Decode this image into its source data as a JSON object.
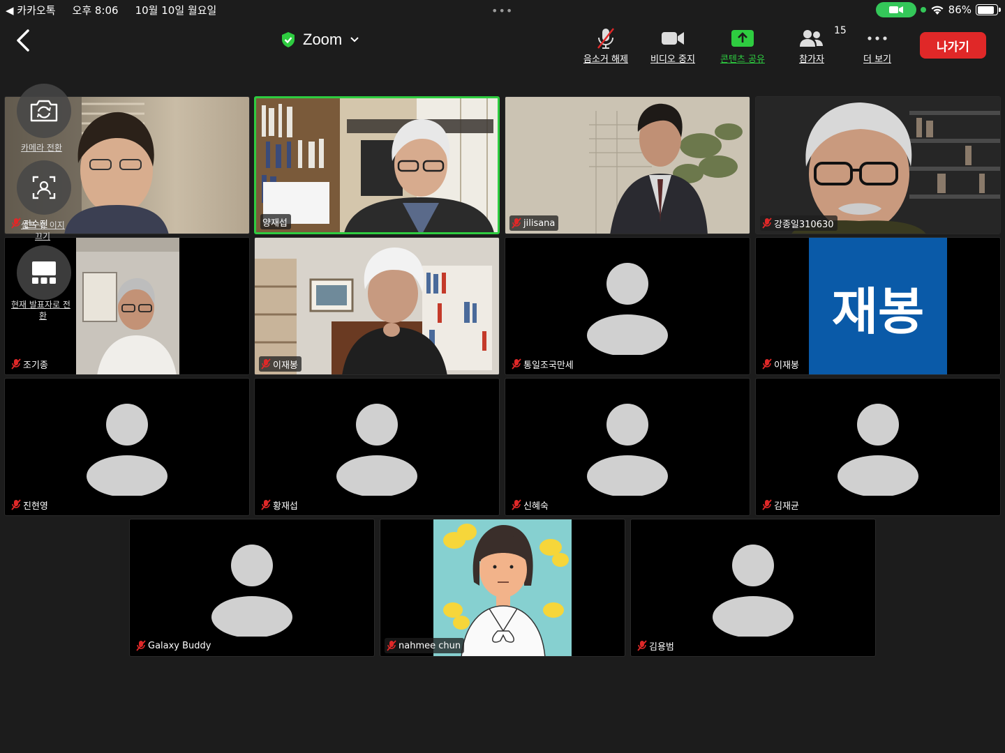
{
  "status_bar": {
    "back_app": "◀ 카카오톡",
    "time": "오후 8:06",
    "date": "10월 10일 월요일",
    "dots": "•••",
    "battery": "86%"
  },
  "toolbar": {
    "title": "Zoom",
    "mute_label": "음소거 해제",
    "video_label": "비디오 중지",
    "share_label": "콘텐츠 공유",
    "participants_label": "참가자",
    "participants_count": "15",
    "more_label": "더 보기",
    "leave_label": "나가기"
  },
  "overlay": {
    "switch_camera": "카메라 전환",
    "hide_self_label_1": "셀프 뷰 이지",
    "hide_self_label_2": "끄기",
    "self_name": "전수진",
    "switch_presenter_1": "현재 발표자로 전",
    "switch_presenter_2": "환"
  },
  "participants": [
    {
      "name": "전수진",
      "muted": true
    },
    {
      "name": "양재섭",
      "muted": false,
      "active": true
    },
    {
      "name": "jilisana",
      "muted": true
    },
    {
      "name": "강종일310630",
      "muted": true
    },
    {
      "name": "조기종",
      "muted": true
    },
    {
      "name": "이재봉",
      "muted": true
    },
    {
      "name": "통일조국만세",
      "muted": true
    },
    {
      "name": "이재봉",
      "muted": true,
      "name_card": "재봉"
    },
    {
      "name": "진현영",
      "muted": true
    },
    {
      "name": "황재섭",
      "muted": true
    },
    {
      "name": "신혜숙",
      "muted": true
    },
    {
      "name": "김재균",
      "muted": true
    },
    {
      "name": "Galaxy Buddy",
      "muted": true
    },
    {
      "name": "nahmee chun",
      "muted": true
    },
    {
      "name": "김용범",
      "muted": true
    }
  ],
  "colors": {
    "background": "#1c1c1c",
    "active_border": "#2ecc40",
    "leave": "#e02828",
    "mute_icon": "#e02828",
    "name_card_bg": "#0a5aa8"
  },
  "icons": [
    "back-icon",
    "shield-check-icon",
    "chevron-down-icon",
    "mic-off-icon",
    "video-icon",
    "share-icon",
    "participants-icon",
    "more-icon",
    "camera-switch-icon",
    "hide-self-icon",
    "presenter-icon",
    "muted-mic-icon"
  ]
}
